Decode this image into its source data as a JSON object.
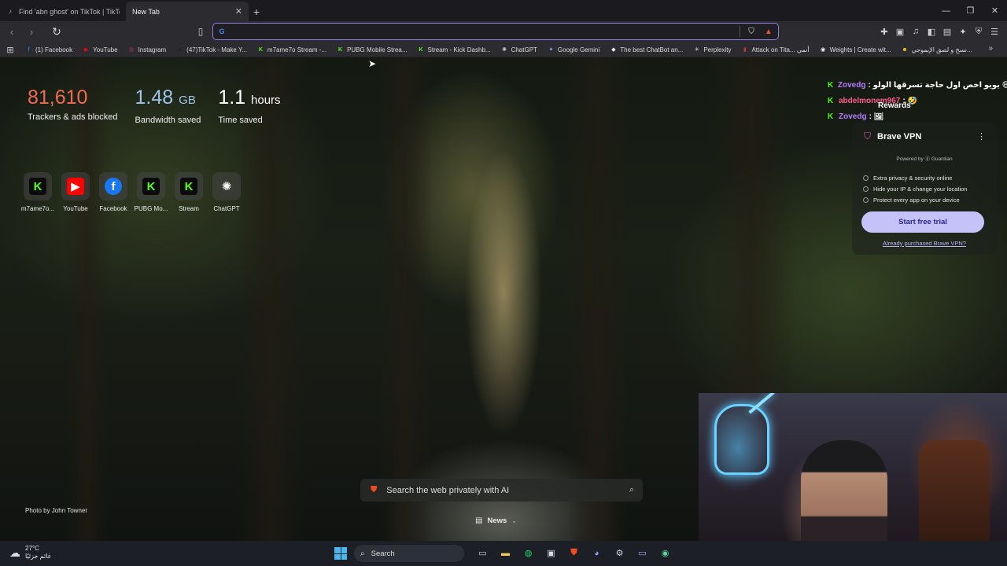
{
  "tabs": [
    {
      "label": "Find 'abn ghost' on TikTok | TikTok Se",
      "active": false
    },
    {
      "label": "New Tab",
      "active": true
    }
  ],
  "toolbar": {
    "address_value": "",
    "address_placeholder": ""
  },
  "bookmarks": [
    {
      "label": "(1) Facebook",
      "icon": "facebook-icon",
      "color": "#1877f2",
      "glyph": "f"
    },
    {
      "label": "YouTube",
      "icon": "youtube-icon",
      "color": "#ff0000",
      "glyph": "▶"
    },
    {
      "label": "Instagram",
      "icon": "instagram-icon",
      "color": "#e1306c",
      "glyph": "◎"
    },
    {
      "label": "(47)TikTok - Make Y...",
      "icon": "tiktok-icon",
      "color": "#111111",
      "glyph": "♪"
    },
    {
      "label": "m7ame7o Stream -...",
      "icon": "kick-icon",
      "color": "#53fc18",
      "glyph": "K"
    },
    {
      "label": "PUBG Mobile Strea...",
      "icon": "kick-icon",
      "color": "#53fc18",
      "glyph": "K"
    },
    {
      "label": "Stream - Kick Dashb...",
      "icon": "kick-icon",
      "color": "#53fc18",
      "glyph": "K"
    },
    {
      "label": "ChatGPT",
      "icon": "chatgpt-icon",
      "color": "#cccccc",
      "glyph": "✺"
    },
    {
      "label": "Google Gemini",
      "icon": "gemini-icon",
      "color": "#8ab4f8",
      "glyph": "✦"
    },
    {
      "label": "The best ChatBot an...",
      "icon": "chatbot-icon",
      "color": "#ffffff",
      "glyph": "◆"
    },
    {
      "label": "Perplexity",
      "icon": "perplexity-icon",
      "color": "#dddddd",
      "glyph": "✳"
    },
    {
      "label": "Attack on Tita... أنمي",
      "icon": "anime-icon",
      "color": "#c0392b",
      "glyph": "▮"
    },
    {
      "label": "Weights | Create wit...",
      "icon": "weights-icon",
      "color": "#ffffff",
      "glyph": "◉"
    },
    {
      "label": "نسخ و لصق الإيموجي...",
      "icon": "emoji-icon",
      "color": "#f5c518",
      "glyph": "☻"
    }
  ],
  "stats": {
    "trackers": {
      "value": "81,610",
      "caption": "Trackers & ads blocked"
    },
    "bandwidth": {
      "value": "1.48",
      "unit": "GB",
      "caption": "Bandwidth saved"
    },
    "time": {
      "value": "1.1",
      "unit": "hours",
      "caption": "Time saved"
    }
  },
  "top_sites": [
    {
      "label": "m7ame7o...",
      "icon": "kick-icon",
      "color": "#53fc18",
      "bg": "#0b0b0b",
      "glyph": "K"
    },
    {
      "label": "YouTube",
      "icon": "youtube-icon",
      "color": "#ffffff",
      "bg": "#ff0000",
      "glyph": "▶"
    },
    {
      "label": "Facebook",
      "icon": "facebook-icon",
      "color": "#ffffff",
      "bg": "#1877f2",
      "glyph": "f"
    },
    {
      "label": "PUBG Mo...",
      "icon": "kick-icon",
      "color": "#53fc18",
      "bg": "#0b0b0b",
      "glyph": "K"
    },
    {
      "label": "Stream",
      "icon": "kick-icon",
      "color": "#53fc18",
      "bg": "#0b0b0b",
      "glyph": "K"
    },
    {
      "label": "ChatGPT",
      "icon": "chatgpt-icon",
      "color": "#ffffff",
      "bg": "transparent",
      "glyph": "✺"
    }
  ],
  "chat": [
    {
      "user": "Zovedg",
      "user_color": "#b57cff",
      "message": ": يويو اخص اول حاجة تسرقها الولو 😄😄😄"
    },
    {
      "user": "abdelmonem967",
      "user_color": "#ff5c8a",
      "message": ": 🤣"
    },
    {
      "user": "Zovedg",
      "user_color": "#b57cff",
      "message": ": 🖼"
    }
  ],
  "rewards_label": "Rewards",
  "vpn": {
    "title": "Brave VPN",
    "powered_by": "Powered by ⓖ Guardian",
    "features": [
      "Extra privacy & security online",
      "Hide your IP & change your location",
      "Protect every app on your device"
    ],
    "cta": "Start free trial",
    "already": "Already purchased Brave VPN?"
  },
  "search": {
    "placeholder": "Search the web privately with AI"
  },
  "news_label": "News",
  "photo_credit": "Photo by John Towner",
  "taskbar": {
    "temperature": "27°C",
    "weather_desc": "غائم جزئيًا",
    "search_label": "Search"
  },
  "accent": "#8b7ce8"
}
